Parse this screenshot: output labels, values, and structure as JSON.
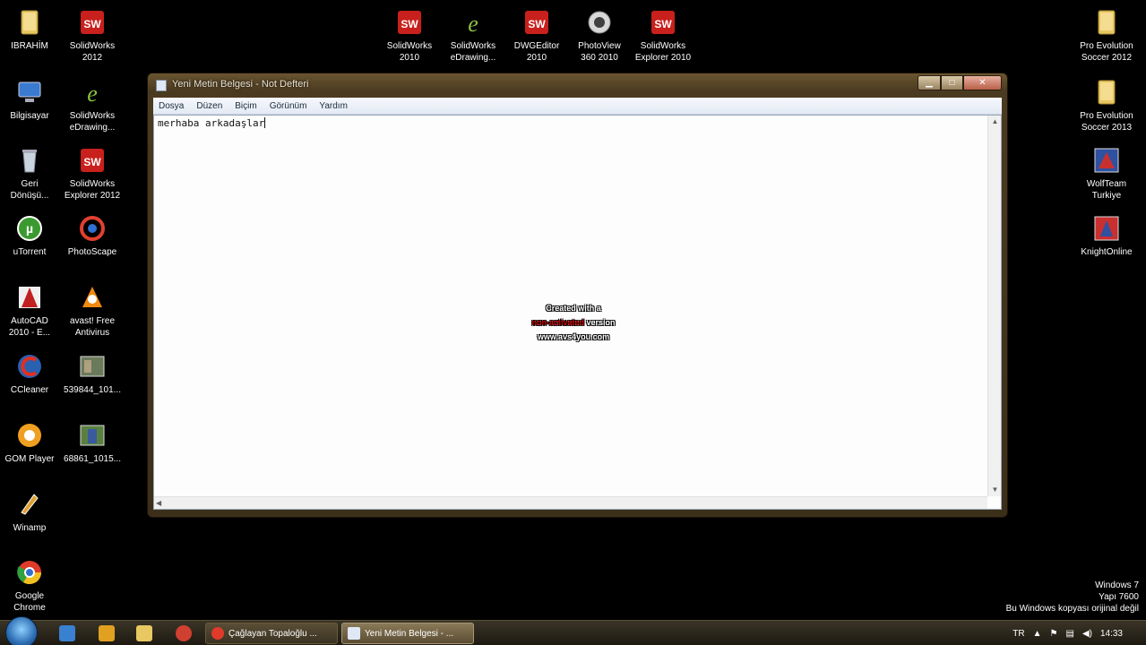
{
  "desktop_icons": {
    "ibrahim": "IBRAHİM",
    "sw2012": [
      "SolidWorks",
      "2012"
    ],
    "sw2010": [
      "SolidWorks",
      "2010"
    ],
    "sw_edrawings_top": [
      "SolidWorks",
      "eDrawing..."
    ],
    "dwgeditor": [
      "DWGEditor",
      "2010"
    ],
    "photoview": [
      "PhotoView",
      "360 2010"
    ],
    "sw_explorer2010": [
      "SolidWorks",
      "Explorer 2010"
    ],
    "pes2012": [
      "Pro Evolution",
      "Soccer 2012"
    ],
    "bilgisayar": "Bilgisayar",
    "sw_edrawings_left": [
      "SolidWorks",
      "eDrawing..."
    ],
    "pes2013": [
      "Pro Evolution",
      "Soccer 2013"
    ],
    "geri": [
      "Geri",
      "Dönüşü..."
    ],
    "sw_explorer2012": [
      "SolidWorks",
      "Explorer 2012"
    ],
    "wolfteam": [
      "WolfTeam",
      "Turkiye"
    ],
    "utorrent": "uTorrent",
    "photoscape": "PhotoScape",
    "knightonline": "KnightOnline",
    "autocad": [
      "AutoCAD",
      "2010 - E..."
    ],
    "avast": [
      "avast! Free",
      "Antivirus"
    ],
    "ccleaner": "CCleaner",
    "img539": "539844_101...",
    "gom": "GOM Player",
    "img688": "68861_1015...",
    "winamp": "Winamp",
    "chrome": [
      "Google",
      "Chrome"
    ]
  },
  "notepad": {
    "title": "Yeni Metin Belgesi - Not Defteri",
    "menu": [
      "Dosya",
      "Düzen",
      "Biçim",
      "Görünüm",
      "Yardım"
    ],
    "content": "merhaba arkadaşlar"
  },
  "watermark": {
    "line1": "Created with a",
    "line2_red": "non-activated",
    "line2_rest": " version",
    "line3": "www.avs4you.com"
  },
  "windows_info": {
    "line1": "Windows 7",
    "line2": "Yapı 7600",
    "line3": "Bu Windows kopyası orijinal değil"
  },
  "taskbar": {
    "tasks": [
      "Çağlayan Topaloğlu ...",
      "Yeni Metin Belgesi - ..."
    ],
    "lang": "TR",
    "clock": "14:33"
  }
}
